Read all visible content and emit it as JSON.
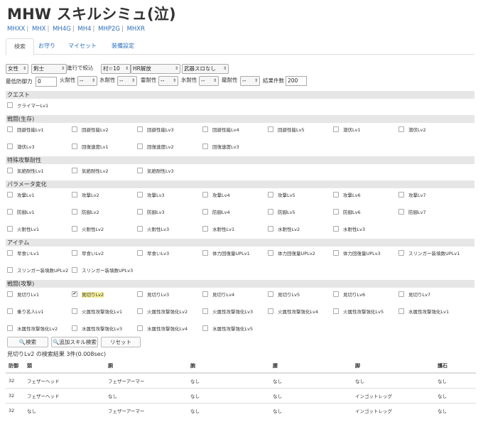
{
  "title": "MHW スキルシミュ(泣)",
  "sites": [
    "MHXX",
    "MHX",
    "MH4G",
    "MH4",
    "MHP2G",
    "MHXR"
  ],
  "tabs": [
    "検索",
    "お守り",
    "マイセット",
    "装備設定"
  ],
  "filters": {
    "gender": "女性",
    "class": "剣士",
    "progress_label": "進行で絞込",
    "village": "村☆10",
    "hr": "HR解放",
    "weapon_slots": "武器スロなし",
    "min_defense_label": "最低防御力",
    "min_defense_value": "0",
    "fire_label": "火耐性",
    "water_label": "水耐性",
    "thunder_label": "雷耐性",
    "ice_label": "氷耐性",
    "dragon_label": "龍耐性",
    "res_value": "--",
    "result_count_label": "結果件数",
    "result_count_value": "200"
  },
  "sections": [
    {
      "name": "クエスト",
      "rows": [
        [
          "クライマーLv1"
        ]
      ]
    },
    {
      "name": "戦闘(生存)",
      "rows": [
        [
          "回避性能Lv1",
          "回避性能Lv2",
          "回避性能Lv3",
          "回避性能Lv4",
          "回避性能Lv5",
          "潜伏Lv1",
          "潜伏Lv2"
        ],
        [
          "潜伏Lv3",
          "回復速度Lv1",
          "回復速度Lv2",
          "回復速度Lv3"
        ]
      ]
    },
    {
      "name": "特殊攻撃耐性",
      "rows": [
        [
          "気絶耐性Lv1",
          "気絶耐性Lv2",
          "気絶耐性Lv3"
        ]
      ]
    },
    {
      "name": "パラメータ変化",
      "rows": [
        [
          "攻撃Lv1",
          "攻撃Lv2",
          "攻撃Lv3",
          "攻撃Lv4",
          "攻撃Lv5",
          "攻撃Lv6",
          "攻撃Lv7"
        ],
        [
          "防御Lv1",
          "防御Lv2",
          "防御Lv3",
          "防御Lv4",
          "防御Lv5",
          "防御Lv6",
          "防御Lv7"
        ],
        [
          "火耐性Lv1",
          "火耐性Lv2",
          "火耐性Lv3",
          "水耐性Lv1",
          "水耐性Lv2",
          "水耐性Lv3"
        ]
      ]
    },
    {
      "name": "アイテム",
      "rows": [
        [
          "早食いLv1",
          "早食いLv2",
          "早食いLv3",
          "体力回復量UPLv1",
          "体力回復量UPLv2",
          "体力回復量UPLv3",
          "スリンガー装填数UPLv1"
        ],
        [
          "スリンガー装填数UPLv2",
          "スリンガー装填数UPLv3"
        ]
      ]
    },
    {
      "name": "戦闘(攻撃)",
      "rows": [
        [
          "見切りLv1",
          "見切りLv2",
          "見切りLv3",
          "見切りLv4",
          "見切りLv5",
          "見切りLv6",
          "見切りLv7"
        ],
        [
          "乗り名人Lv1",
          "火属性攻撃強化Lv1",
          "火属性攻撃強化Lv2",
          "火属性攻撃強化Lv3",
          "火属性攻撃強化Lv4",
          "火属性攻撃強化Lv5",
          "水属性攻撃強化Lv1"
        ],
        [
          "水属性攻撃強化Lv2",
          "水属性攻撃強化Lv3",
          "水属性攻撃強化Lv4",
          "水属性攻撃強化Lv5"
        ]
      ]
    }
  ],
  "checked_skill": "見切りLv2",
  "buttons": {
    "search": "検索",
    "add_skill_search": "追加スキル検索",
    "reset": "リセット"
  },
  "result_text": "見切りLv2 の検索結果 3件(0.008sec)",
  "table": {
    "headers": [
      "防御",
      "頭",
      "胴",
      "腕",
      "腰",
      "脚",
      "護石"
    ],
    "rows": [
      [
        "32",
        "フェザーヘッド",
        "フェザーアーマー",
        "なし",
        "なし",
        "なし",
        "なし"
      ],
      [
        "32",
        "フェザーヘッド",
        "なし",
        "なし",
        "なし",
        "インゴットレッグ",
        "なし"
      ],
      [
        "32",
        "なし",
        "フェザーアーマー",
        "なし",
        "なし",
        "インゴットレッグ",
        "なし"
      ]
    ]
  }
}
